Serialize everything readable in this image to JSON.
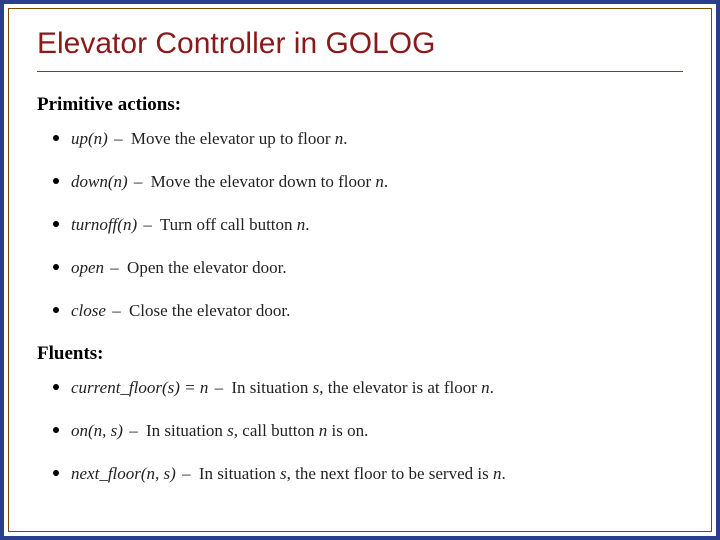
{
  "title": "Elevator Controller in GOLOG",
  "sections": [
    {
      "heading": "Primitive actions:",
      "items": [
        {
          "term": "up(n)",
          "desc": "Move the elevator up to floor n."
        },
        {
          "term": "down(n)",
          "desc": "Move the elevator down to floor n."
        },
        {
          "term": "turnoff(n)",
          "desc": "Turn off call button n."
        },
        {
          "term": "open",
          "desc": "Open the elevator door."
        },
        {
          "term": "close",
          "desc": "Close the elevator door."
        }
      ]
    },
    {
      "heading": "Fluents:",
      "items": [
        {
          "term": "current_floor(s) = n",
          "desc": "In situation s, the elevator is at floor n."
        },
        {
          "term": "on(n, s)",
          "desc": "In situation s, call button n is on."
        },
        {
          "term": "next_floor(n, s)",
          "desc": "In situation s, the next floor to be served is n."
        }
      ]
    }
  ],
  "separator": "–"
}
